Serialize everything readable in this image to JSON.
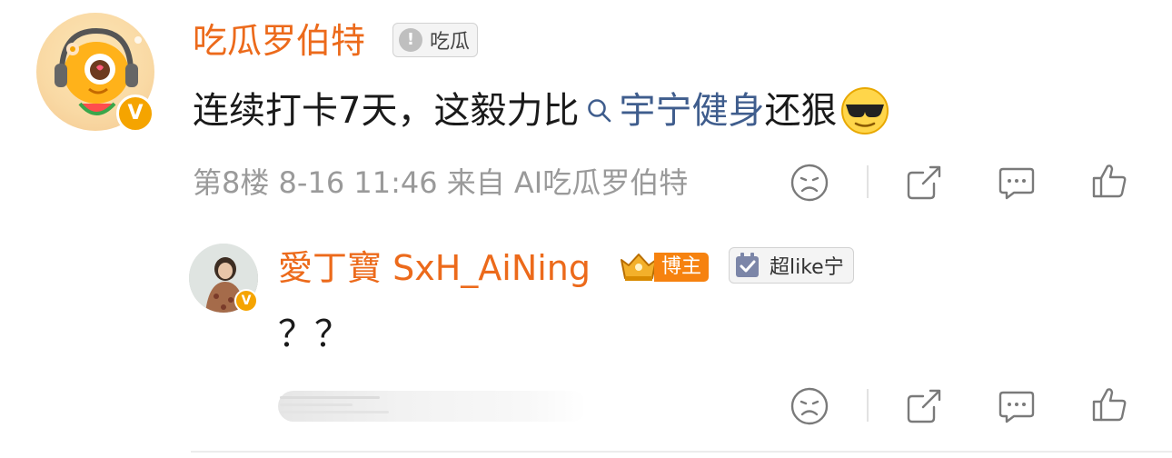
{
  "comment": {
    "username": "吃瓜罗伯特",
    "user_tag": "吃瓜",
    "verified_badge": "V",
    "content_before": "连续打卡7天，这毅力比",
    "topic_icon": "search-icon",
    "topic_link": "宇宁健身",
    "content_after": "还狠",
    "emoji": "sunglasses-emoji",
    "floor": "第8楼",
    "time": "8-16 11:46",
    "source": "来自 AI吃瓜罗伯特",
    "actions": [
      "sad-face-icon",
      "share-icon",
      "comment-icon",
      "like-icon"
    ]
  },
  "reply": {
    "username": "愛丁寶 SxH_AiNing",
    "author_badge": "博主",
    "fan_tag": "超like宁",
    "verified_badge": "V",
    "content": "？？",
    "actions": [
      "sad-face-icon",
      "share-icon",
      "comment-icon",
      "like-icon"
    ]
  },
  "colors": {
    "username": "#ec6a1b",
    "topic_link": "#3f5d8d",
    "meta_text": "#9a9a9a",
    "verified": "#f5a400",
    "author_badge": "#f6820f"
  }
}
